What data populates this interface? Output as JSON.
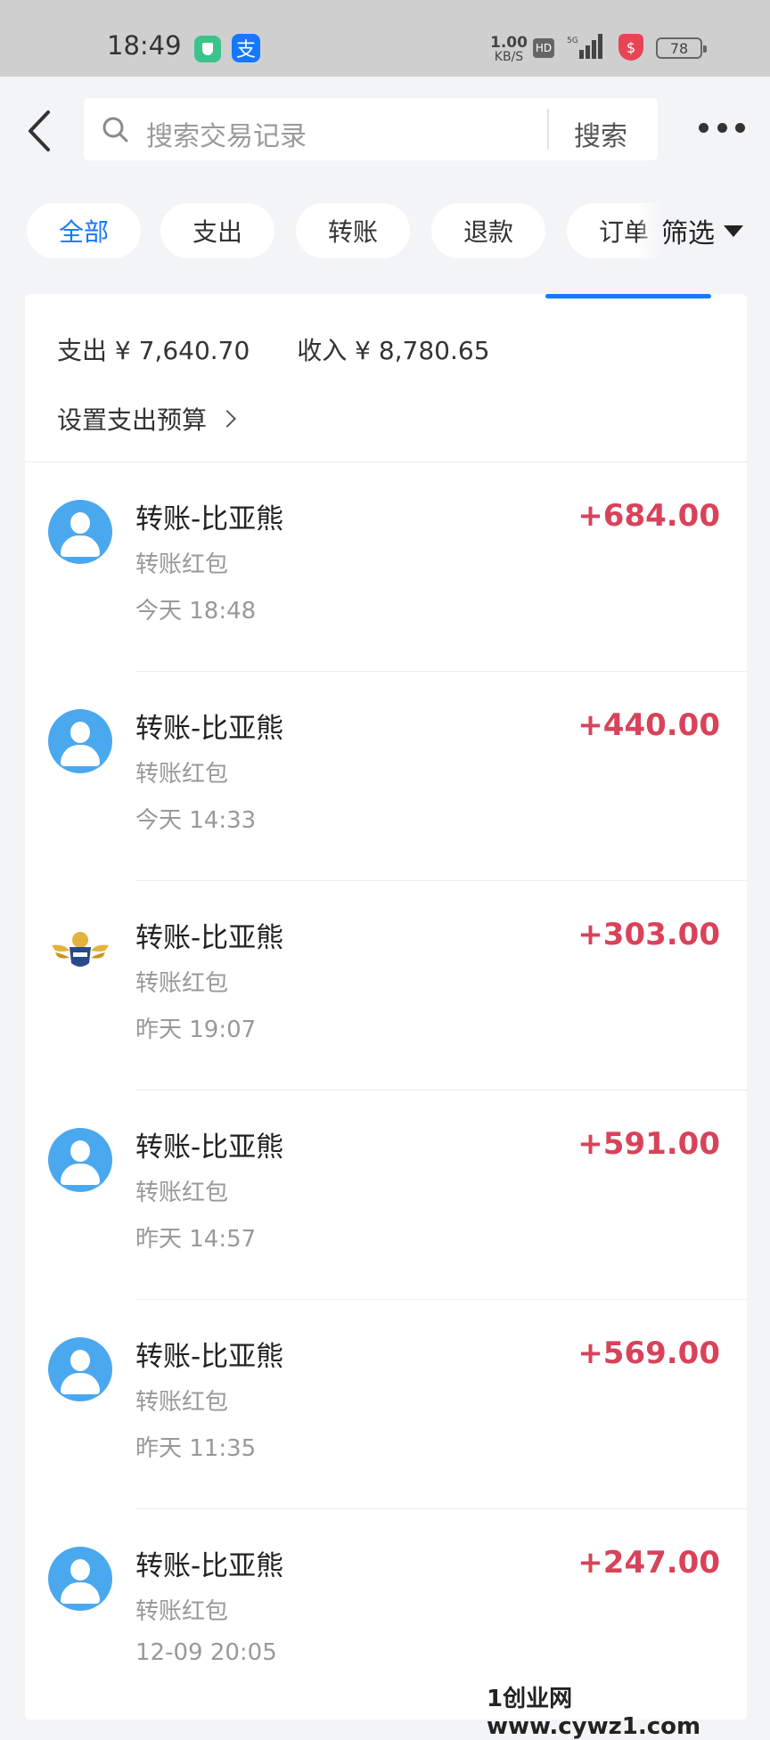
{
  "status_bar": {
    "time": "18:49",
    "net_speed_value": "1.00",
    "net_speed_unit": "KB/S",
    "hd": "HD",
    "network": "5G",
    "battery": "78"
  },
  "search": {
    "placeholder": "搜索交易记录",
    "button": "搜索"
  },
  "filters": {
    "chips": [
      "全部",
      "支出",
      "转账",
      "退款",
      "订单"
    ],
    "active": "全部",
    "screen_label": "筛选"
  },
  "summary": {
    "expense": "支出 ¥ 7,640.70",
    "income": "收入 ¥ 8,780.65",
    "budget_link": "设置支出预算"
  },
  "transactions": [
    {
      "title": "转账-比亚熊",
      "sub": "转账红包",
      "time": "今天 18:48",
      "amount": "+684.00",
      "icon": "default-avatar-icon"
    },
    {
      "title": "转账-比亚熊",
      "sub": "转账红包",
      "time": "今天 14:33",
      "amount": "+440.00",
      "icon": "default-avatar-icon"
    },
    {
      "title": "转账-比亚熊",
      "sub": "转账红包",
      "time": "昨天 19:07",
      "amount": "+303.00",
      "icon": "winged-badge-logo-icon"
    },
    {
      "title": "转账-比亚熊",
      "sub": "转账红包",
      "time": "昨天 14:57",
      "amount": "+591.00",
      "icon": "default-avatar-icon"
    },
    {
      "title": "转账-比亚熊",
      "sub": "转账红包",
      "time": "昨天 11:35",
      "amount": "+569.00",
      "icon": "default-avatar-icon"
    },
    {
      "title": "转账-比亚熊",
      "sub": "转账红包",
      "time": "12-09 20:05",
      "amount": "+247.00",
      "icon": "default-avatar-icon"
    }
  ],
  "watermark": "1创业网www.cywz1.com",
  "colors": {
    "accent": "#1677ff",
    "amount": "#d8435a",
    "background": "#f3f4f6"
  }
}
